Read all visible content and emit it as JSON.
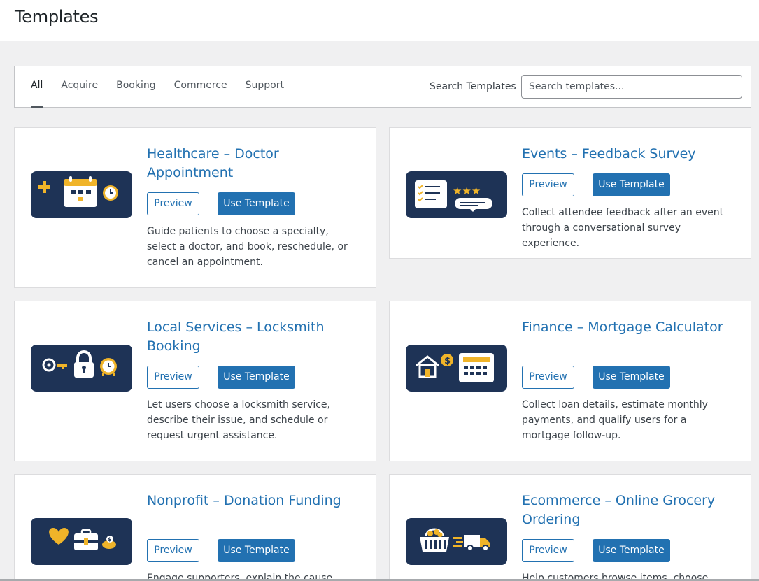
{
  "page": {
    "title": "Templates"
  },
  "filters": {
    "tabs": [
      "All",
      "Acquire",
      "Booking",
      "Commerce",
      "Support"
    ],
    "active_tab": "All",
    "search_label": "Search Templates",
    "search_placeholder": "Search templates...",
    "search_value": ""
  },
  "templates": [
    {
      "title": "Healthcare – Doctor Appointment",
      "preview_label": "Preview",
      "use_label": "Use Template",
      "description": "Guide patients to choose a specialty, select a doctor, and book, reschedule, or cancel an appointment.",
      "icon": "calendar-clock-icon"
    },
    {
      "title": "Events – Feedback Survey",
      "preview_label": "Preview",
      "use_label": "Use Template",
      "description": "Collect attendee feedback after an event through a conversational survey experience.",
      "icon": "feedback-survey-icon"
    },
    {
      "title": "Local Services – Locksmith Booking",
      "preview_label": "Preview",
      "use_label": "Use Template",
      "description": "Let users choose a locksmith service, describe their issue, and schedule or request urgent assistance.",
      "icon": "lock-key-icon"
    },
    {
      "title": "Finance – Mortgage Calculator",
      "preview_label": "Preview",
      "use_label": "Use Template",
      "description": "Collect loan details, estimate monthly payments, and qualify users for a mortgage follow-up.",
      "icon": "house-calculator-icon"
    },
    {
      "title": "Nonprofit – Donation Funding",
      "preview_label": "Preview",
      "use_label": "Use Template",
      "description": "Engage supporters, explain the cause, and",
      "icon": "donation-heart-icon"
    },
    {
      "title": "Ecommerce – Online Grocery Ordering",
      "preview_label": "Preview",
      "use_label": "Use Template",
      "description": "Help customers browse items, choose delivery",
      "icon": "grocery-delivery-icon"
    }
  ],
  "colors": {
    "accent": "#2271b1",
    "thumb_bg": "#1e3356",
    "thumb_yellow": "#f0b429"
  }
}
